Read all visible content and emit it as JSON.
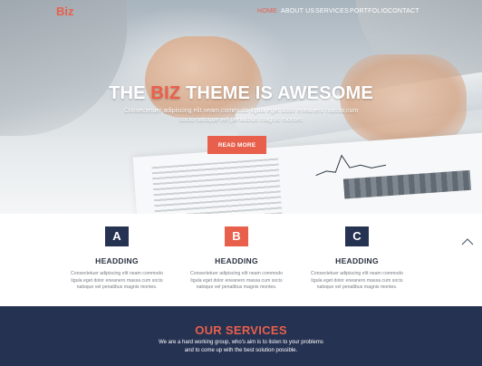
{
  "brand": {
    "logo": "Biz",
    "accent_color": "#e8604c",
    "dark_color": "#263252"
  },
  "nav": {
    "items": [
      {
        "label": "HOME",
        "active": true
      },
      {
        "label": "ABOUT US",
        "active": false
      },
      {
        "label": "SERVICES",
        "active": false
      },
      {
        "label": "PORTFOLIO",
        "active": false
      },
      {
        "label": "CONTACT",
        "active": false
      }
    ]
  },
  "hero": {
    "title_part1": "THE",
    "title_accent": "BIZ",
    "title_part2": "THEME IS AWESOME",
    "subtitle": "Consectetuer adipiscing elit neam commodo ligula eget dolor eneanero massa cum socio natoque vel penatibus magnis montes",
    "button": "READ MORE"
  },
  "features": [
    {
      "letter": "A",
      "title": "HEADDING",
      "text": "Consectetuer adipiscing elit neam commodo ligula eget dolor eneanero massa cum socis natoque vel penatibus magnis montes.",
      "color": "#263252"
    },
    {
      "letter": "B",
      "title": "HEADDING",
      "text": "Consectetuer adipiscing elit neam commodo ligula eget dolor eneanero massa cum socis natoque vel penatibus magnis montes.",
      "color": "#e8604c"
    },
    {
      "letter": "C",
      "title": "HEADDING",
      "text": "Consectetuer adipiscing elit neam commodo ligula eget dolor eneanero massa cum socis natoque vel penatibus magnis montes.",
      "color": "#263252"
    }
  ],
  "scroll_icon": "chevron-up-icon",
  "services": {
    "title": "OUR SERVICES",
    "line1": "We are a hard working group, who's aim is to listen to your problems",
    "line2": "and to come up with the best solution possible."
  }
}
